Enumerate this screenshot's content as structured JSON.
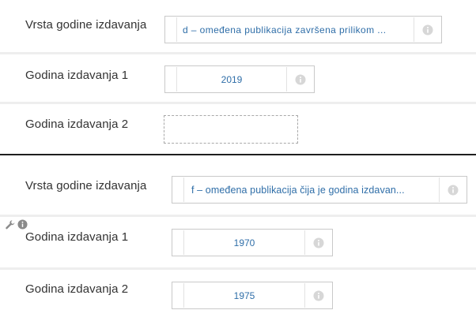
{
  "panel_a": {
    "vrsta_label": "Vrsta godine izdavanja",
    "vrsta_value": "d – omeđena publikacija završena prilikom ...",
    "godina1_label": "Godina izdavanja 1",
    "godina1_value": "2019",
    "godina2_label": "Godina izdavanja 2",
    "godina2_value": ""
  },
  "panel_b": {
    "vrsta_label": "Vrsta godine izdavanja",
    "vrsta_value": "f – omeđena publikacija čija je godina izdavan...",
    "godina1_label": "Godina izdavanja 1",
    "godina1_value": "1970",
    "godina2_label": "Godina izdavanja 2",
    "godina2_value": "1975"
  },
  "icons": {
    "info": "info-icon",
    "edit": "wrench-icon",
    "info_small": "info-icon"
  },
  "colors": {
    "value_text": "#2f6ea8",
    "label_text": "#333333",
    "field_border": "#c9c9c9",
    "row_separator": "#eeeeee"
  }
}
